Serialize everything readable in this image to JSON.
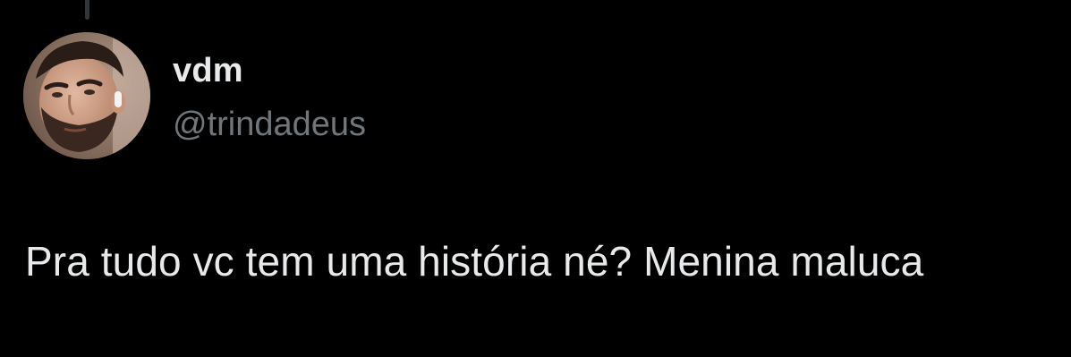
{
  "tweet": {
    "author": {
      "display_name": "vdm",
      "handle": "@trindadeus",
      "avatar_icon": "user-avatar"
    },
    "text": "Pra tudo vc tem uma história né? Menina maluca"
  },
  "colors": {
    "background": "#000000",
    "primary_text": "#e7e9ea",
    "secondary_text": "#71767b",
    "thread_line": "#333639"
  }
}
